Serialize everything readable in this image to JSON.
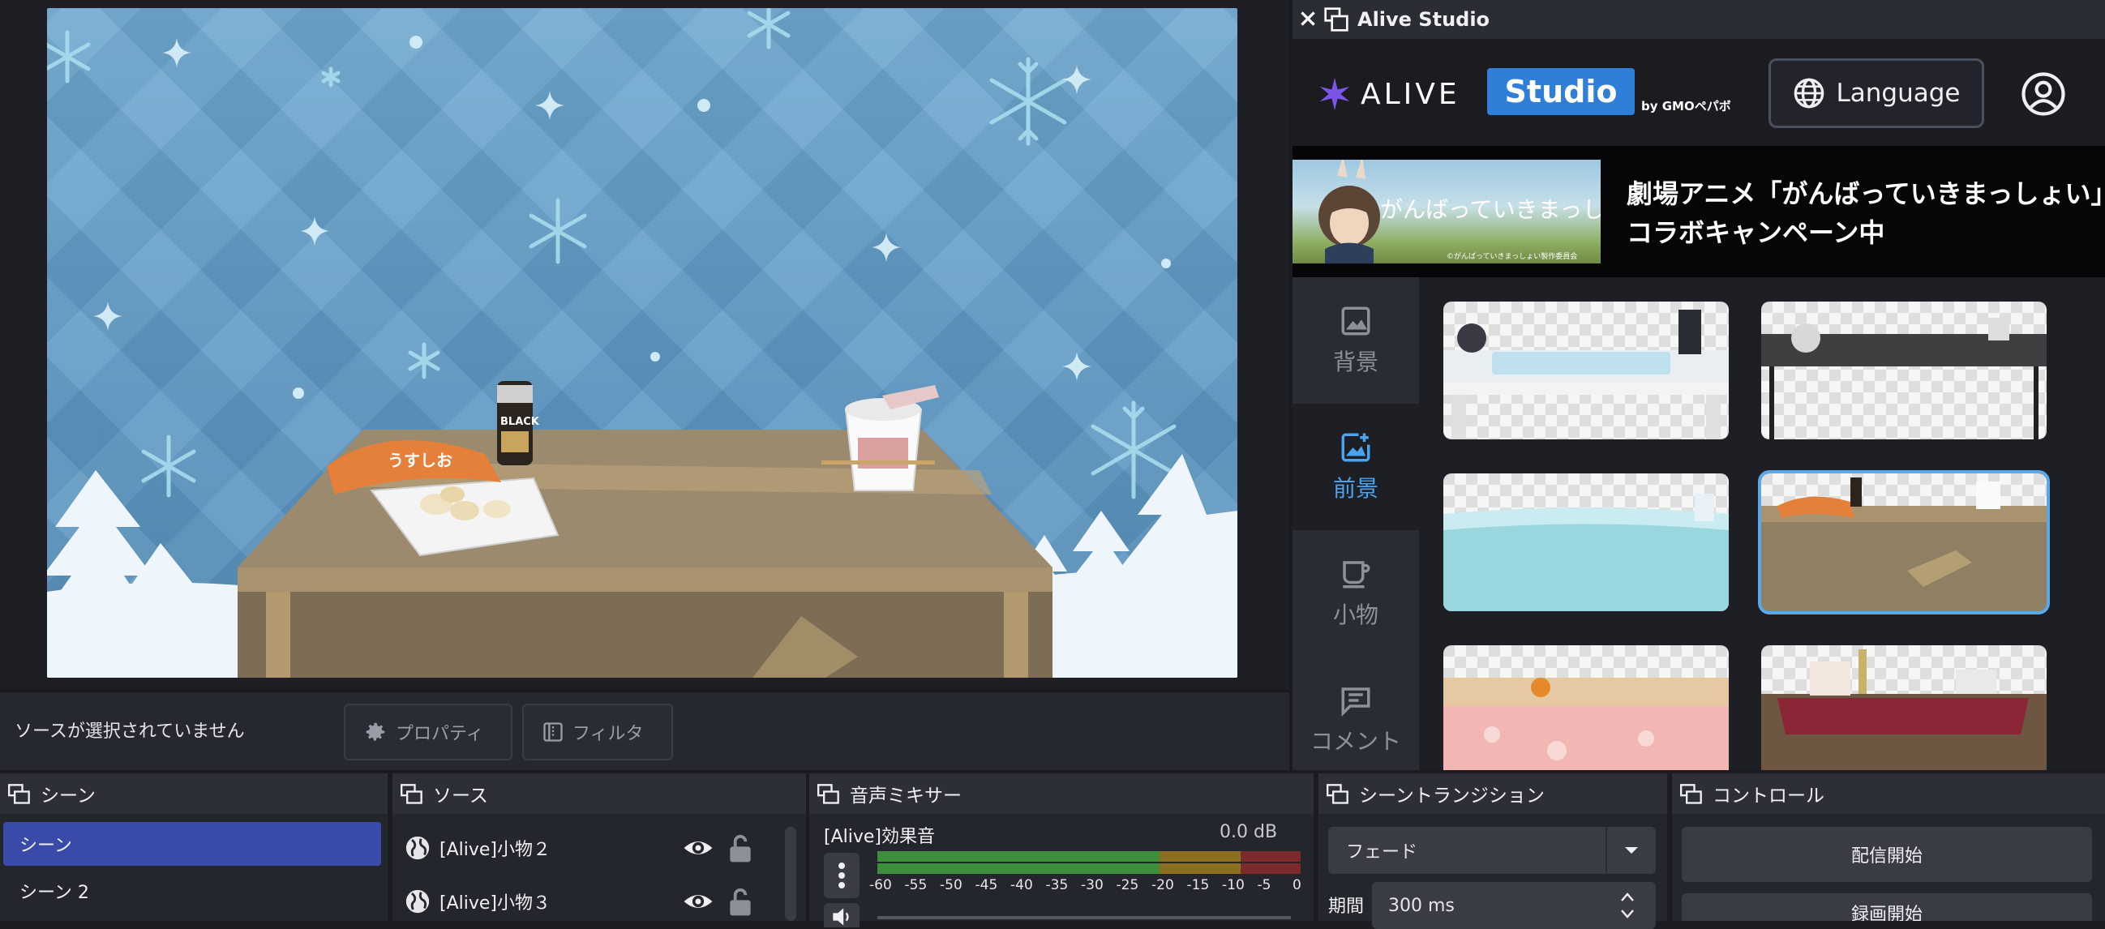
{
  "source_toolbar": {
    "no_source_label": "ソースが選択されていません",
    "properties_label": "プロパティ",
    "filters_label": "フィルタ"
  },
  "dock": {
    "title": "Alive Studio",
    "header": {
      "logo_text": "ALIVE",
      "studio_badge": "Studio",
      "by_label": "by GMOペパボ",
      "language_label": "Language"
    },
    "banner": {
      "image_title": "がんばっていきまっしょい",
      "image_credit": "©がんばっていきまっしょい製作委員会",
      "line1": "劇場アニメ「がんばっていきまっしょい」",
      "line2": "コラボキャンペーン中"
    },
    "categories": [
      {
        "label": "背景",
        "icon": "image-icon"
      },
      {
        "label": "前景",
        "icon": "add-image-icon",
        "active": true
      },
      {
        "label": "小物",
        "icon": "cup-icon"
      },
      {
        "label": "コメント",
        "icon": "comment-icon"
      }
    ]
  },
  "panels": {
    "scenes": {
      "title": "シーン",
      "items": [
        "シーン",
        "シーン 2"
      ]
    },
    "sources": {
      "title": "ソース",
      "items": [
        "[Alive]小物２",
        "[Alive]小物３"
      ]
    },
    "mixer": {
      "title": "音声ミキサー",
      "channel_name": "[Alive]効果音",
      "level": "0.0 dB",
      "scale": [
        "-60",
        "-55",
        "-50",
        "-45",
        "-40",
        "-35",
        "-30",
        "-25",
        "-20",
        "-15",
        "-10",
        "-5",
        "0"
      ]
    },
    "transitions": {
      "title": "シーントランジション",
      "selected": "フェード",
      "duration_label": "期間",
      "duration_value": "300 ms"
    },
    "controls": {
      "title": "コントロール",
      "start_stream": "配信開始",
      "start_recording": "録画開始"
    }
  },
  "colors": {
    "accent_blue": "#4aa3ef",
    "scene_active": "#3a4aa8",
    "panel_bg": "#24262d"
  },
  "canvas_text": {
    "can_label": "BLACK",
    "chips_label": "うすしお"
  }
}
